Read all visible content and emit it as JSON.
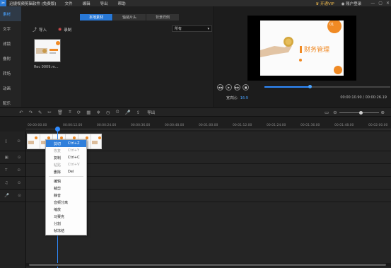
{
  "app": {
    "logo": "✂",
    "title": "迅捷视频剪辑软件 (免费版)",
    "menu": [
      "文件",
      "编辑",
      "导出",
      "帮助"
    ],
    "vip": "开通VIP",
    "account": "账户登录",
    "window_controls": [
      "—",
      "▢",
      "✕"
    ]
  },
  "left_nav": [
    "素材",
    "文字",
    "滤镜",
    "叠附",
    "转场",
    "动画",
    "配乐"
  ],
  "media": {
    "tabs": [
      "本地素材",
      "轴装片头",
      "背景样例"
    ],
    "import_label": "导入",
    "record_label": "录制",
    "filter_value": "所有",
    "thumb_label": "Rec 0009.m..."
  },
  "preview": {
    "slide_title": "财务管理",
    "slide_badge": "01",
    "aspect_label": "宽高比:",
    "aspect_value": "16:9",
    "timecode": "00:00:10.90 / 00:00:26.19",
    "progress": 0.36
  },
  "toolbar": {
    "export_label": "导出",
    "icons": [
      "undo-icon",
      "redo-icon",
      "edit-icon",
      "cut-icon",
      "delete-icon",
      "crop-icon",
      "rotate-icon",
      "mosaic-icon",
      "freeze-icon",
      "speed-icon",
      "duration-icon",
      "mic-icon",
      "export-icon"
    ]
  },
  "ruler": [
    "00:00:00.00",
    "00:00:12.00",
    "00:00:24.00",
    "00:00:36.00",
    "00:00:48.00",
    "00:01:00.00",
    "00:01:12.00",
    "00:01:24.00",
    "00:01:36.00",
    "00:01:48.00",
    "00:02:00.00"
  ],
  "context_menu": [
    {
      "label": "剪切",
      "shortcut": "Ctrl+Z",
      "state": "active"
    },
    {
      "label": "恢复",
      "shortcut": "Ctrl+Y",
      "state": "disabled"
    },
    {
      "label": "复制",
      "shortcut": "Ctrl+C",
      "state": "normal"
    },
    {
      "label": "粘贴",
      "shortcut": "Ctrl+V",
      "state": "disabled"
    },
    {
      "label": "删除",
      "shortcut": "Del",
      "state": "normal"
    },
    {
      "sep": true
    },
    {
      "label": "编辑",
      "state": "normal"
    },
    {
      "label": "裁剪",
      "state": "normal"
    },
    {
      "label": "静音",
      "state": "normal"
    },
    {
      "label": "音频分离",
      "state": "normal"
    },
    {
      "label": "缩放",
      "state": "normal"
    },
    {
      "label": "马赛克",
      "state": "normal"
    },
    {
      "label": "分割",
      "state": "normal"
    },
    {
      "label": "帧冻结",
      "state": "normal"
    }
  ],
  "colors": {
    "accent": "#2f8bff",
    "vip": "#e9b54a",
    "slide_accent": "#f08a24"
  }
}
